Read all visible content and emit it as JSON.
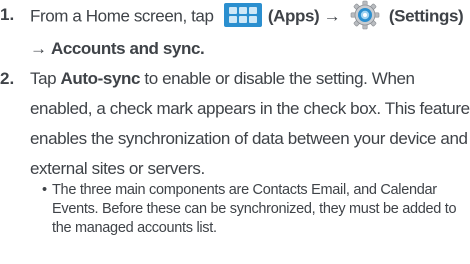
{
  "steps": [
    {
      "number": "1.",
      "line1_prefix": "From a Home screen, tap",
      "apps_label": "(Apps)",
      "arrow": "→",
      "settings_label": "(Settings)",
      "line2_arrow": "→",
      "line2_target": "Accounts and sync",
      "line2_suffix": "."
    },
    {
      "number": "2.",
      "prefix": "Tap ",
      "bold": "Auto-sync",
      "rest": " to enable or disable the setting. When enabled, a check mark appears in the check box. This feature enables the synchronization of data between your device and external sites or servers."
    }
  ],
  "bullet": {
    "dot": "•",
    "text": "The three main components are Contacts Email, and Calendar Events. Before these can be synchronized, they must be added to the managed accounts list."
  },
  "icons": {
    "apps": "apps-grid-icon",
    "settings": "settings-gear-icon"
  },
  "colors": {
    "text": "#3f4348",
    "apps_icon": "#2b8fcf"
  }
}
